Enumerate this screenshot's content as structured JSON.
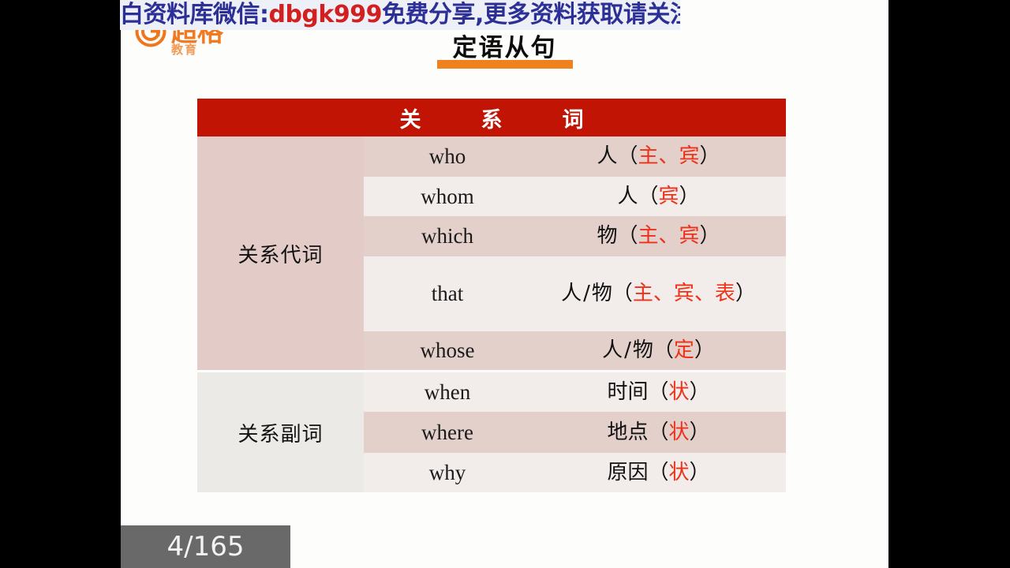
{
  "slide": {
    "title": "定语从句",
    "page_indicator": "4/165",
    "accent_orange": "#f0821e",
    "header_red": "#c21404",
    "highlight_red": "#ee3119",
    "page_box_gray": "#696969"
  },
  "brand": {
    "mark": "g-circle-icon",
    "word": "超格",
    "sub": "教育"
  },
  "watermark": {
    "part1": "大白资料库微信:",
    "code": "dbgk999",
    "part2": "免费分享,更多资料获取请关注!"
  },
  "table": {
    "header": "关系词",
    "groups": [
      {
        "label": "关系代词",
        "rows": [
          {
            "word": "who",
            "noun": "人",
            "sep": "",
            "paren_open": "（",
            "tags": "主、宾",
            "paren_close": "）",
            "tags2": ""
          },
          {
            "word": "whom",
            "noun": "人",
            "sep": "",
            "paren_open": "（",
            "tags": "宾",
            "paren_close": "）",
            "tags2": ""
          },
          {
            "word": "which",
            "noun": "物",
            "sep": "",
            "paren_open": "（",
            "tags": "主、宾",
            "paren_close": "）",
            "tags2": ""
          },
          {
            "word": "that",
            "noun": "人",
            "sep": "/",
            "noun2": "物",
            "paren_open": "（",
            "tags": "主、宾、",
            "tags2": "表",
            "paren_close": "）"
          },
          {
            "word": "whose",
            "noun": "人",
            "sep": "/",
            "noun2": "物",
            "paren_open": "（",
            "tags": "定",
            "paren_close": "）",
            "tags2": ""
          }
        ]
      },
      {
        "label": "关系副词",
        "rows": [
          {
            "word": "when",
            "noun": "时间",
            "sep": "",
            "paren_open": "（",
            "tags": "状",
            "paren_close": "）",
            "tags2": ""
          },
          {
            "word": "where",
            "noun": "地点",
            "sep": "",
            "paren_open": "（",
            "tags": "状",
            "paren_close": "）",
            "tags2": ""
          },
          {
            "word": "why",
            "noun": "原因",
            "sep": "",
            "paren_open": "（",
            "tags": "状",
            "paren_close": "）",
            "tags2": ""
          }
        ]
      }
    ]
  }
}
